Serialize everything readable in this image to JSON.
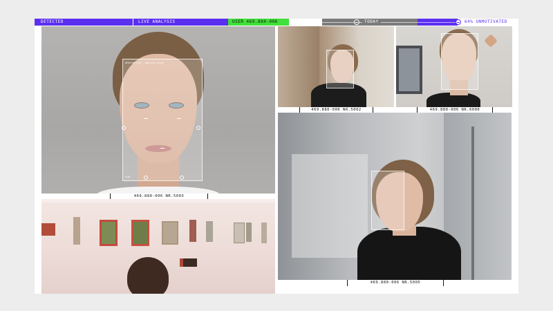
{
  "status_bar": {
    "detected": "DETECTED",
    "live_analysis": "LIVE ANALYSIS",
    "user": "USER 469.880-006",
    "today": "TODAY",
    "unmotivated": "64% UNMOTIVATED"
  },
  "panels": {
    "main_portrait": {
      "caption": "469.880-006 NR.5003"
    },
    "office_left": {
      "caption": "469.880-006 NR.5002"
    },
    "office_right": {
      "caption": "469.880-006 NR.6000"
    },
    "office_large": {
      "caption": "469.880-006 NR.5005"
    }
  },
  "colors": {
    "accent": "#5b2ff0",
    "user_green": "#41e03a",
    "today_gray": "#7a7a7a"
  }
}
